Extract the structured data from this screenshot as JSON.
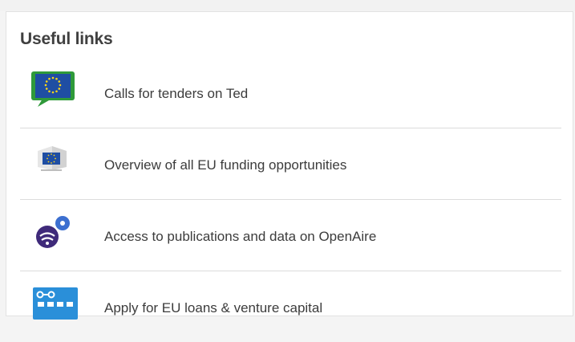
{
  "panel": {
    "title": "Useful links",
    "links": [
      {
        "label": "Calls for tenders on Ted",
        "icon": "ted-eu-flag-speech-bubble-icon"
      },
      {
        "label": "Overview of all EU funding opportunities",
        "icon": "european-commission-logo-icon"
      },
      {
        "label": "Access to publications and data on OpenAire",
        "icon": "openaire-logo-icon"
      },
      {
        "label": "Apply for EU loans & venture capital",
        "icon": "access-to-finance-icon"
      }
    ]
  },
  "colors": {
    "eu_blue": "#1f4ea3",
    "eu_yellow": "#ffd617",
    "ted_green": "#2f9a3a",
    "openaire_purple": "#3f2a7a",
    "openaire_blue": "#3c6fd0",
    "finance_blue": "#2a8fd9",
    "divider": "#dcdcdc",
    "text": "#3c3c3c",
    "title": "#404040"
  }
}
